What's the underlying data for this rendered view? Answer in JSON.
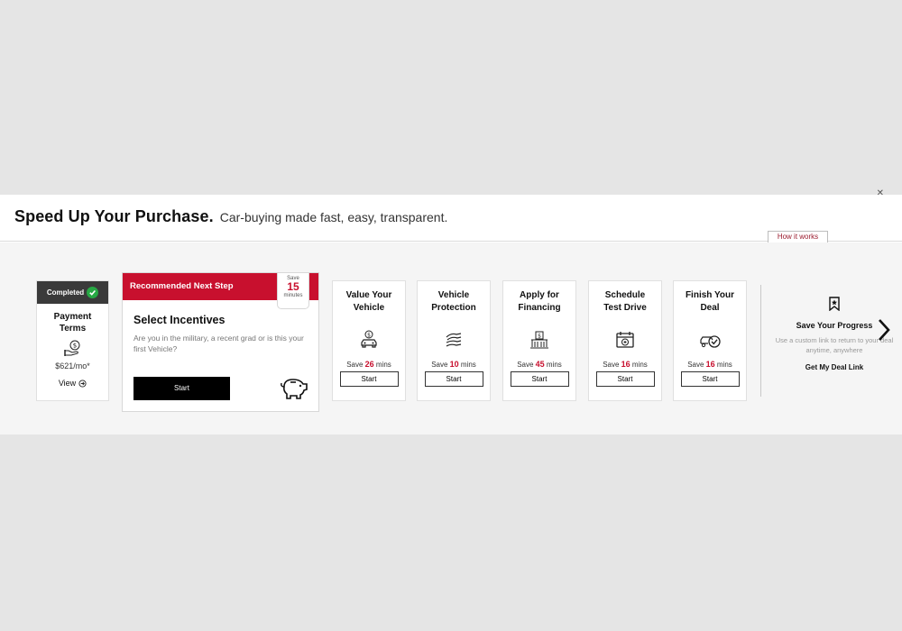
{
  "header": {
    "title": "Speed Up Your Purchase.",
    "subtitle": "Car-buying made fast, easy, transparent.",
    "how_it_works": "How it works"
  },
  "completed_card": {
    "badge": "Completed",
    "title_line1": "Payment",
    "title_line2": "Terms",
    "amount": "$621/mo*",
    "view_label": "View"
  },
  "recommended": {
    "banner": "Recommended Next Step",
    "save_label": "Save",
    "save_number": "15",
    "save_unit": "minutes",
    "title": "Select Incentives",
    "description": "Are you in the military, a recent grad or is this your first Vehicle?",
    "start_label": "Start"
  },
  "steps": [
    {
      "line1": "Value Your",
      "line2": "Vehicle",
      "save_prefix": "Save",
      "minutes": "26",
      "unit": "mins",
      "start_label": "Start",
      "icon": "car-dollar-icon"
    },
    {
      "line1": "Vehicle",
      "line2": "Protection",
      "save_prefix": "Save",
      "minutes": "10",
      "unit": "mins",
      "start_label": "Start",
      "icon": "protection-hands-icon"
    },
    {
      "line1": "Apply for",
      "line2": "Financing",
      "save_prefix": "Save",
      "minutes": "45",
      "unit": "mins",
      "start_label": "Start",
      "icon": "bank-icon"
    },
    {
      "line1": "Schedule",
      "line2": "Test Drive",
      "save_prefix": "Save",
      "minutes": "16",
      "unit": "mins",
      "start_label": "Start",
      "icon": "calendar-icon"
    },
    {
      "line1": "Finish Your",
      "line2": "Deal",
      "save_prefix": "Save",
      "minutes": "16",
      "unit": "mins",
      "start_label": "Start",
      "icon": "car-check-icon"
    }
  ],
  "save_progress": {
    "title": "Save Your Progress",
    "description": "Use a custom link to return to your deal anytime, anywhere",
    "link": "Get My Deal Link"
  },
  "colors": {
    "accent": "#c8102e",
    "completed_bar": "#3a3a3a",
    "check": "#27a844"
  }
}
